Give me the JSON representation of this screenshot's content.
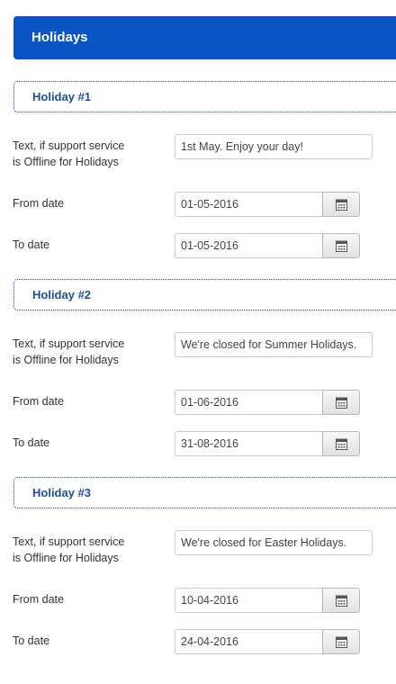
{
  "header": {
    "title": "Holidays"
  },
  "labels": {
    "text_line1": "Text, if support service",
    "text_line2": "is Offline for Holidays",
    "from_date": "From date",
    "to_date": "To date"
  },
  "holidays": [
    {
      "title": "Holiday #1",
      "text": "1st May. Enjoy your day!",
      "from": "01-05-2016",
      "to": "01-05-2016"
    },
    {
      "title": "Holiday #2",
      "text": "We're closed for Summer Holidays.",
      "from": "01-06-2016",
      "to": "31-08-2016"
    },
    {
      "title": "Holiday #3",
      "text": "We're closed for Easter Holidays.",
      "from": "10-04-2016",
      "to": "24-04-2016"
    }
  ],
  "colors": {
    "header_bg": "#0a55c6",
    "section_title": "#1d4fa0"
  },
  "icons": {
    "date_picker": "calendar-icon"
  }
}
